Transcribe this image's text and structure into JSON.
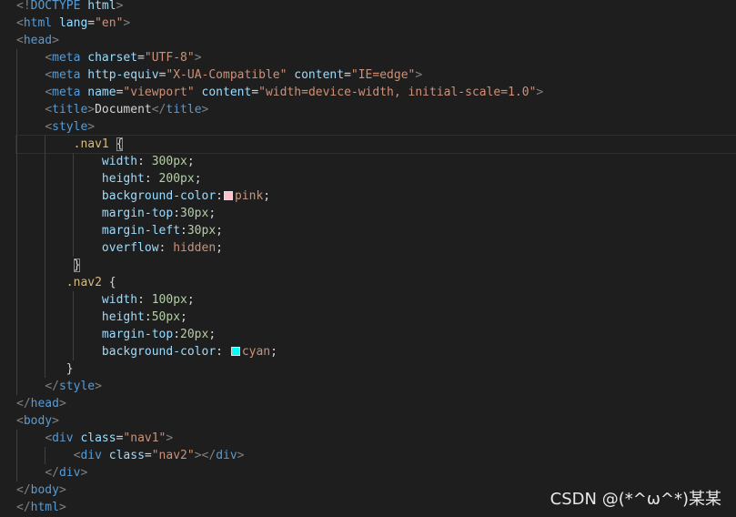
{
  "lines": {
    "l1": {
      "open": "<!",
      "doctype": "DOCTYPE",
      "html": "html",
      "close": ">"
    },
    "l2": {
      "open": "<",
      "tag": "html",
      "attr": "lang",
      "eq": "=",
      "val": "\"en\"",
      "close": ">"
    },
    "l3": {
      "open": "<",
      "tag": "head",
      "close": ">"
    },
    "l4": {
      "open": "<",
      "tag": "meta",
      "attr": "charset",
      "eq": "=",
      "val": "\"UTF-8\"",
      "close": ">"
    },
    "l5": {
      "open": "<",
      "tag": "meta",
      "attr1": "http-equiv",
      "eq1": "=",
      "val1": "\"X-UA-Compatible\"",
      "attr2": "content",
      "eq2": "=",
      "val2": "\"IE=edge\"",
      "close": ">"
    },
    "l6": {
      "open": "<",
      "tag": "meta",
      "attr1": "name",
      "eq1": "=",
      "val1": "\"viewport\"",
      "attr2": "content",
      "eq2": "=",
      "val2": "\"width=device-width, initial-scale=1.0\"",
      "close": ">"
    },
    "l7": {
      "open": "<",
      "tag": "title",
      "close": ">",
      "text": "Document",
      "open2": "</",
      "tag2": "title",
      "close2": ">"
    },
    "l8": {
      "open": "<",
      "tag": "style",
      "close": ">"
    },
    "l9": {
      "selector": ".nav1",
      "brace": "{"
    },
    "l10": {
      "prop": "width",
      "colon": ": ",
      "num": "300px",
      "semi": ";"
    },
    "l11": {
      "prop": "height",
      "colon": ": ",
      "num": "200px",
      "semi": ";"
    },
    "l12": {
      "prop": "background-color",
      "colon": ":",
      "val": "pink",
      "semi": ";",
      "swatch": "#ffc0cb"
    },
    "l13": {
      "prop": "margin-top",
      "colon": ":",
      "num": "30px",
      "semi": ";"
    },
    "l14": {
      "prop": "margin-left",
      "colon": ":",
      "num": "30px",
      "semi": ";"
    },
    "l15": {
      "prop": "overflow",
      "colon": ": ",
      "val": "hidden",
      "semi": ";"
    },
    "l16": {
      "brace": "}"
    },
    "l17": {
      "selector": ".nav2",
      "brace": "{"
    },
    "l18": {
      "prop": "width",
      "colon": ": ",
      "num": "100px",
      "semi": ";"
    },
    "l19": {
      "prop": "height",
      "colon": ":",
      "num": "50px",
      "semi": ";"
    },
    "l20": {
      "prop": "margin-top",
      "colon": ":",
      "num": "20px",
      "semi": ";"
    },
    "l21": {
      "prop": "background-color",
      "colon": ": ",
      "val": "cyan",
      "semi": ";",
      "swatch": "#00ffff"
    },
    "l22": {
      "brace": "}"
    },
    "l23": {
      "open": "</",
      "tag": "style",
      "close": ">"
    },
    "l24": {
      "open": "</",
      "tag": "head",
      "close": ">"
    },
    "l25": {
      "open": "<",
      "tag": "body",
      "close": ">"
    },
    "l26": {
      "open": "<",
      "tag": "div",
      "attr": "class",
      "eq": "=",
      "val": "\"nav1\"",
      "close": ">"
    },
    "l27": {
      "open": "<",
      "tag": "div",
      "attr": "class",
      "eq": "=",
      "val": "\"nav2\"",
      "close": ">",
      "open2": "</",
      "tag2": "div",
      "close2": ">"
    },
    "l28": {
      "open": "</",
      "tag": "div",
      "close": ">"
    },
    "l29": {
      "open": "</",
      "tag": "body",
      "close": ">"
    },
    "l30": {
      "open": "</",
      "tag": "html",
      "close": ">"
    }
  },
  "watermark": "CSDN @(*^ω^*)某某"
}
